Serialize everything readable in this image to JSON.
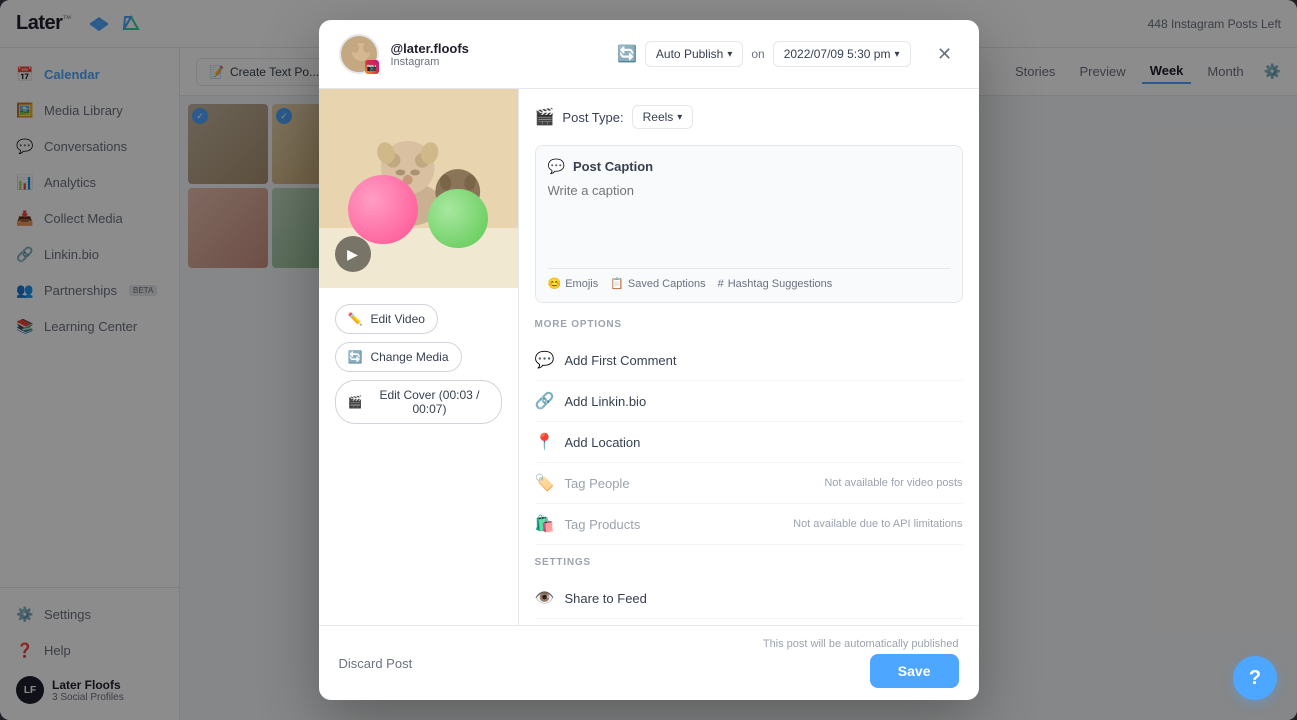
{
  "app": {
    "title": "Later",
    "title_sup": "™",
    "posts_left": "448 Instagram Posts Left"
  },
  "sidebar": {
    "items": [
      {
        "label": "Calendar",
        "icon": "📅",
        "active": true
      },
      {
        "label": "Media Library",
        "icon": "🖼️",
        "active": false
      },
      {
        "label": "Conversations",
        "icon": "💬",
        "active": false
      },
      {
        "label": "Analytics",
        "icon": "📊",
        "active": false
      },
      {
        "label": "Collect Media",
        "icon": "📥",
        "active": false
      },
      {
        "label": "Linkin.bio",
        "icon": "🔗",
        "active": false
      },
      {
        "label": "Partnerships",
        "icon": "👥",
        "active": false
      },
      {
        "label": "Learning Center",
        "icon": "📚",
        "active": false
      }
    ],
    "bottom_items": [
      {
        "label": "Settings",
        "icon": "⚙️"
      },
      {
        "label": "Help",
        "icon": "❓"
      }
    ],
    "user": {
      "initials": "LF",
      "name": "Later Floofs",
      "sub": "3 Social Profiles"
    }
  },
  "toolbar": {
    "create_btn": "Create Text Po...",
    "tabs": [
      "Stories",
      "Preview",
      "Week",
      "Month"
    ]
  },
  "modal": {
    "profile_name": "@later.floofs",
    "platform": "Instagram",
    "publish_mode": "Auto Publish",
    "on_label": "on",
    "schedule_date": "2022/07/09 5:30 pm",
    "close_icon": "✕",
    "post_type_label": "Post Type:",
    "post_type_value": "Reels",
    "caption_title": "Post Caption",
    "caption_placeholder": "Write a caption",
    "caption_tools": [
      {
        "label": "Emojis",
        "icon": "😊"
      },
      {
        "label": "Saved Captions",
        "icon": "📋"
      },
      {
        "label": "Hashtag Suggestions",
        "icon": "#"
      }
    ],
    "more_options_label": "MORE OPTIONS",
    "options": [
      {
        "label": "Add First Comment",
        "icon": "💬",
        "note": "",
        "disabled": false
      },
      {
        "label": "Add Linkin.bio",
        "icon": "🔗",
        "note": "",
        "disabled": false
      },
      {
        "label": "Add Location",
        "icon": "📍",
        "note": "",
        "disabled": false
      },
      {
        "label": "Tag People",
        "icon": "🏷️",
        "note": "Not available for video posts",
        "disabled": true
      },
      {
        "label": "Tag Products",
        "icon": "🛍️",
        "note": "Not available due to API limitations",
        "disabled": true
      }
    ],
    "settings_label": "SETTINGS",
    "settings_items": [
      {
        "label": "Share to Feed",
        "icon": "👁️"
      }
    ],
    "auto_note": "This post will be automatically published",
    "media_actions": [
      {
        "label": "Edit Video",
        "icon": "✏️"
      },
      {
        "label": "Change Media",
        "icon": "🔄"
      },
      {
        "label": "Edit Cover (00:03 / 00:07)",
        "icon": "🎬"
      }
    ],
    "discard_btn": "Discard Post",
    "save_btn": "Save"
  },
  "help": {
    "icon": "?"
  }
}
